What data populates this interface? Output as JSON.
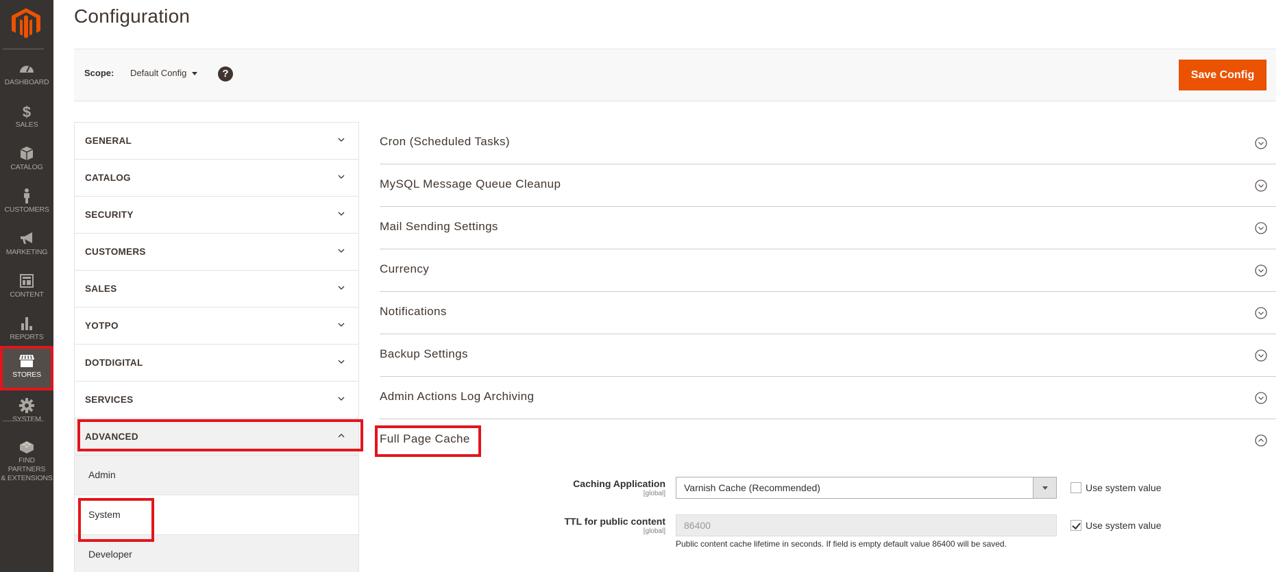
{
  "admin_nav": {
    "logo": "magento-logo",
    "items": [
      {
        "label": "DASHBOARD",
        "icon": "dashboard-icon"
      },
      {
        "label": "SALES",
        "icon": "dollar-icon"
      },
      {
        "label": "CATALOG",
        "icon": "box-icon"
      },
      {
        "label": "CUSTOMERS",
        "icon": "person-icon"
      },
      {
        "label": "MARKETING",
        "icon": "megaphone-icon"
      },
      {
        "label": "CONTENT",
        "icon": "layout-icon"
      },
      {
        "label": "REPORTS",
        "icon": "bar-chart-icon"
      },
      {
        "label": "STORES",
        "icon": "storefront-icon",
        "active": true
      },
      {
        "label": "SYSTEM",
        "icon": "gear-icon"
      },
      {
        "label_line1": "FIND PARTNERS",
        "label_line2": "& EXTENSIONS",
        "icon": "lego-brick-icon"
      }
    ]
  },
  "header": {
    "title": "Configuration"
  },
  "scope_bar": {
    "label": "Scope:",
    "selected": "Default Config",
    "help": "?",
    "save_label": "Save Config"
  },
  "config_tabs": [
    {
      "label": "GENERAL"
    },
    {
      "label": "CATALOG"
    },
    {
      "label": "SECURITY"
    },
    {
      "label": "CUSTOMERS"
    },
    {
      "label": "SALES"
    },
    {
      "label": "YOTPO"
    },
    {
      "label": "DOTDIGITAL"
    },
    {
      "label": "SERVICES"
    },
    {
      "label": "ADVANCED",
      "open": true,
      "children": [
        {
          "label": "Admin"
        },
        {
          "label": "System",
          "current": true
        },
        {
          "label": "Developer"
        }
      ]
    }
  ],
  "sections": [
    {
      "title": "Cron (Scheduled Tasks)",
      "state": "collapsed"
    },
    {
      "title": "MySQL Message Queue Cleanup",
      "state": "collapsed"
    },
    {
      "title": "Mail Sending Settings",
      "state": "collapsed"
    },
    {
      "title": "Currency",
      "state": "collapsed"
    },
    {
      "title": "Notifications",
      "state": "collapsed"
    },
    {
      "title": "Backup Settings",
      "state": "collapsed"
    },
    {
      "title": "Admin Actions Log Archiving",
      "state": "collapsed"
    },
    {
      "title": "Full Page Cache",
      "state": "expanded"
    }
  ],
  "full_page_cache": {
    "caching_application": {
      "label": "Caching Application",
      "scope": "[global]",
      "value": "Varnish Cache (Recommended)",
      "use_system_value_label": "Use system value",
      "use_system_value": false
    },
    "ttl": {
      "label": "TTL for public content",
      "scope": "[global]",
      "value": "86400",
      "note": "Public content cache lifetime in seconds. If field is empty default value 86400 will be saved.",
      "use_system_value_label": "Use system value",
      "use_system_value": true
    }
  },
  "colors": {
    "sidebar_bg": "#373330",
    "accent": "#eb5202",
    "highlight": "#e3151c"
  }
}
